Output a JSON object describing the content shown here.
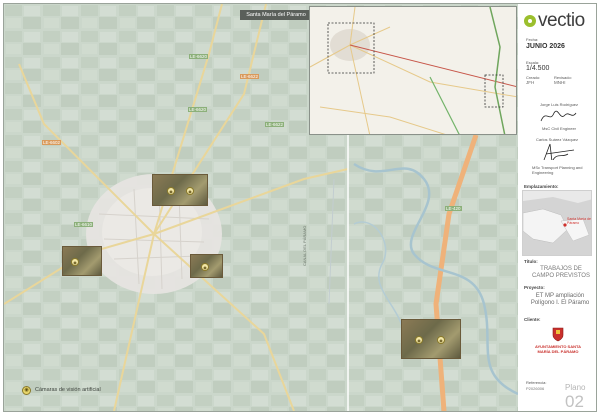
{
  "map": {
    "title": "Santa María del Páramo",
    "road_labels": [
      "LE-6620",
      "LE-6622",
      "LE-6620",
      "LE-6602",
      "LE-6622",
      "LE-6610",
      "LE-420",
      "CANAL DEL PÁRAMO"
    ],
    "legend": {
      "label": "Cámaras de visión artificial",
      "icon": "camera-icon",
      "color": "#e7d56a"
    }
  },
  "panel": {
    "logo_text": "vectio",
    "brand_color": "#9bbf2d",
    "fecha_label": "Fecha:",
    "fecha_value": "JUNIO 2026",
    "escala_label": "Escala:",
    "escala_value": "1/4.500",
    "creado_label": "Creado:",
    "creado_value": "JFH",
    "revisado_label": "Revisado:",
    "revisado_value": "MNHI",
    "signer1_name": "Jorge Luis Rodríguez",
    "signer1_role": "MsC Civil Engineer",
    "signer2_name": "Carlos Suárez Vázquez",
    "signer2_role": "MSc Transport Planning and Engineering",
    "emplazamiento_label": "Emplazamiento:",
    "location_label": "Santa María del Páramo",
    "titulo_label": "Título:",
    "titulo_value": "TRABAJOS DE CAMPO PREVISTOS",
    "proyecto_label": "Proyecto:",
    "proyecto_value": "ET MP ampliación Polígono I. El Páramo",
    "cliente_label": "Cliente:",
    "cliente_value": "AYUNTAMIENTO SANTA MARÍA DEL PÁRAMO",
    "referencia_label": "Referencia:",
    "referencia_value": "P2026006",
    "plano_label": "Plano",
    "plano_number": "02"
  }
}
